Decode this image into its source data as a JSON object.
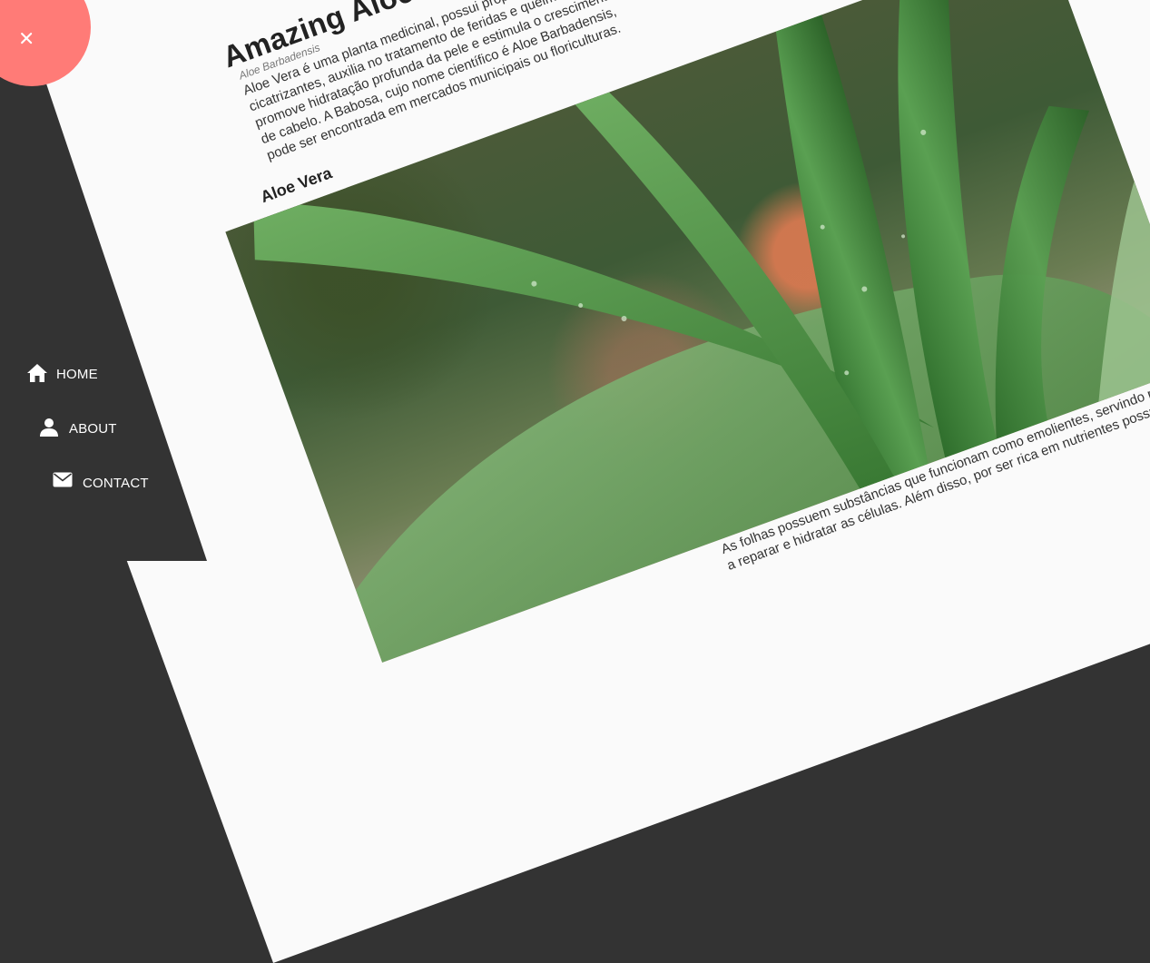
{
  "article": {
    "title": "Amazing Aloe Vera",
    "subtitle": "Aloe Barbadensis",
    "intro": "Aloe Vera é uma planta medicinal, possui propriedades cicatrizantes, auxilia no tratamento de feridas e queimaduras, promove hidratação profunda da pele e estimula o crescimento de cabelo. A Babosa, cujo nome científico é Aloe Barbadensis, pode ser encontrada em mercados municipais ou floriculturas.",
    "section_heading": "Aloe Vera",
    "image_alt": "aloe-vera-photo",
    "body_text": "As folhas possuem substâncias que funcionam como emolientes, servindo para renovar as células e ajudar a reparar e hidratar as células. Além disso, por ser rica em nutrientes possuindo efeito cicatrizante."
  },
  "nav": {
    "items": [
      {
        "label": "HOME",
        "icon": "home-icon"
      },
      {
        "label": "ABOUT",
        "icon": "user-icon"
      },
      {
        "label": "CONTACT",
        "icon": "envelope-icon"
      }
    ],
    "close_icon": "close-icon"
  },
  "colors": {
    "nav_background": "#333333",
    "close_button": "#ff7b77",
    "page_background": "#fafafa"
  }
}
